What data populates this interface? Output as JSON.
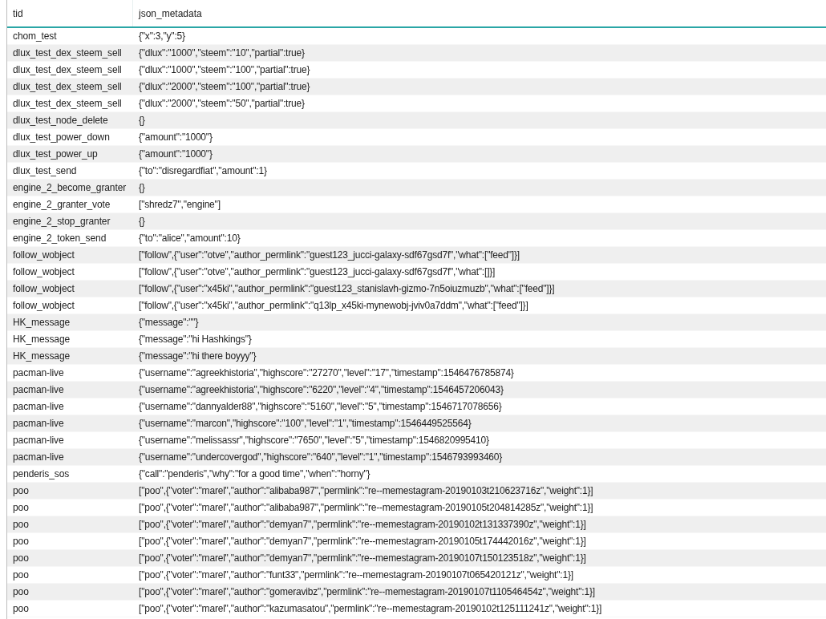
{
  "table": {
    "columns": [
      "tid",
      "json_metadata"
    ],
    "rows": [
      [
        "chom_test",
        "{\"x\":3,\"y\":5}"
      ],
      [
        "dlux_test_dex_steem_sell",
        "{\"dlux\":\"1000\",\"steem\":\"10\",\"partial\":true}"
      ],
      [
        "dlux_test_dex_steem_sell",
        "{\"dlux\":\"1000\",\"steem\":\"100\",\"partial\":true}"
      ],
      [
        "dlux_test_dex_steem_sell",
        "{\"dlux\":\"2000\",\"steem\":\"100\",\"partial\":true}"
      ],
      [
        "dlux_test_dex_steem_sell",
        "{\"dlux\":\"2000\",\"steem\":\"50\",\"partial\":true}"
      ],
      [
        "dlux_test_node_delete",
        "{}"
      ],
      [
        "dlux_test_power_down",
        "{\"amount\":\"1000\"}"
      ],
      [
        "dlux_test_power_up",
        "{\"amount\":\"1000\"}"
      ],
      [
        "dlux_test_send",
        "{\"to\":\"disregardfiat\",\"amount\":1}"
      ],
      [
        "engine_2_become_granter",
        "{}"
      ],
      [
        "engine_2_granter_vote",
        "[\"shredz7\",\"engine\"]"
      ],
      [
        "engine_2_stop_granter",
        "{}"
      ],
      [
        "engine_2_token_send",
        "{\"to\":\"alice\",\"amount\":10}"
      ],
      [
        "follow_wobject",
        "[\"follow\",{\"user\":\"otve\",\"author_permlink\":\"guest123_jucci-galaxy-sdf67gsd7f\",\"what\":[\"feed\"]}]"
      ],
      [
        "follow_wobject",
        "[\"follow\",{\"user\":\"otve\",\"author_permlink\":\"guest123_jucci-galaxy-sdf67gsd7f\",\"what\":[]}]"
      ],
      [
        "follow_wobject",
        "[\"follow\",{\"user\":\"x45ki\",\"author_permlink\":\"guest123_stanislavh-gizmo-7n5oiuzmuzb\",\"what\":[\"feed\"]}]"
      ],
      [
        "follow_wobject",
        "[\"follow\",{\"user\":\"x45ki\",\"author_permlink\":\"q13lp_x45ki-mynewobj-jviv0a7ddm\",\"what\":[\"feed\"]}]"
      ],
      [
        "HK_message",
        "{\"message\":\"\"}"
      ],
      [
        "HK_message",
        "{\"message\":\"hi Hashkings\"}"
      ],
      [
        "HK_message",
        "{\"message\":\"hi there boyyy\"}"
      ],
      [
        "pacman-live",
        "{\"username\":\"agreekhistoria\",\"highscore\":\"27270\",\"level\":\"17\",\"timestamp\":1546476785874}"
      ],
      [
        "pacman-live",
        "{\"username\":\"agreekhistoria\",\"highscore\":\"6220\",\"level\":\"4\",\"timestamp\":1546457206043}"
      ],
      [
        "pacman-live",
        "{\"username\":\"dannyalder88\",\"highscore\":\"5160\",\"level\":\"5\",\"timestamp\":1546717078656}"
      ],
      [
        "pacman-live",
        "{\"username\":\"marcon\",\"highscore\":\"100\",\"level\":\"1\",\"timestamp\":1546449525564}"
      ],
      [
        "pacman-live",
        "{\"username\":\"melissassr\",\"highscore\":\"7650\",\"level\":\"5\",\"timestamp\":1546820995410}"
      ],
      [
        "pacman-live",
        "{\"username\":\"undercovergod\",\"highscore\":\"640\",\"level\":\"1\",\"timestamp\":1546793993460}"
      ],
      [
        "penderis_sos",
        "{\"call\":\"penderis\",\"why\":\"for a good time\",\"when\":\"horny\"}"
      ],
      [
        "poo",
        "[\"poo\",{\"voter\":\"marel\",\"author\":\"alibaba987\",\"permlink\":\"re--memestagram-20190103t210623716z\",\"weight\":1}]"
      ],
      [
        "poo",
        "[\"poo\",{\"voter\":\"marel\",\"author\":\"alibaba987\",\"permlink\":\"re--memestagram-20190105t204814285z\",\"weight\":1}]"
      ],
      [
        "poo",
        "[\"poo\",{\"voter\":\"marel\",\"author\":\"demyan7\",\"permlink\":\"re--memestagram-20190102t131337390z\",\"weight\":1}]"
      ],
      [
        "poo",
        "[\"poo\",{\"voter\":\"marel\",\"author\":\"demyan7\",\"permlink\":\"re--memestagram-20190105t174442016z\",\"weight\":1}]"
      ],
      [
        "poo",
        "[\"poo\",{\"voter\":\"marel\",\"author\":\"demyan7\",\"permlink\":\"re--memestagram-20190107t150123518z\",\"weight\":1}]"
      ],
      [
        "poo",
        "[\"poo\",{\"voter\":\"marel\",\"author\":\"funt33\",\"permlink\":\"re--memestagram-20190107t065420121z\",\"weight\":1}]"
      ],
      [
        "poo",
        "[\"poo\",{\"voter\":\"marel\",\"author\":\"gomeravibz\",\"permlink\":\"re--memestagram-20190107t110546454z\",\"weight\":1}]"
      ],
      [
        "poo",
        "[\"poo\",{\"voter\":\"marel\",\"author\":\"kazumasatou\",\"permlink\":\"re--memestagram-20190102t125111241z\",\"weight\":1}]"
      ]
    ]
  }
}
